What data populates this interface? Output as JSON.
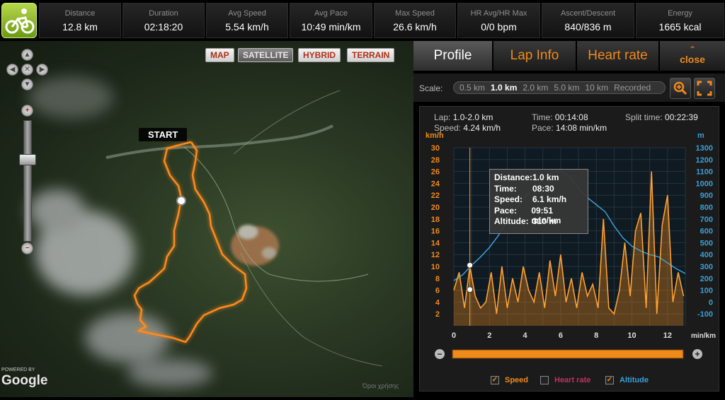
{
  "stats": [
    {
      "label": "Distance",
      "value": "12.8 km"
    },
    {
      "label": "Duration",
      "value": "02:18:20"
    },
    {
      "label": "Avg Speed",
      "value": "5.54 km/h"
    },
    {
      "label": "Avg Pace",
      "value": "10:49 min/km"
    },
    {
      "label": "Max Speed",
      "value": "26.6 km/h"
    },
    {
      "label": "HR Avg/HR Max",
      "value": "0/0 bpm"
    },
    {
      "label": "Ascent/Descent",
      "value": "840/836 m"
    },
    {
      "label": "Energy",
      "value": "1665 kcal"
    }
  ],
  "sport_icon": "cycling-icon",
  "map": {
    "types": [
      "MAP",
      "SATELLITE",
      "HYBRID",
      "TERRAIN"
    ],
    "active_type": "SATELLITE",
    "start_label": "START",
    "powered_by": "POWERED BY",
    "google": "Google",
    "terms": "Όροι χρήσης",
    "route_color": "#ff8a1c"
  },
  "panel": {
    "tabs": [
      "Profile",
      "Lap Info",
      "Heart rate"
    ],
    "active_tab": "Profile",
    "close_label": "close",
    "scale_label": "Scale:",
    "scale_options": [
      "0.5 km",
      "1.0 km",
      "2.0 km",
      "5.0 km",
      "10 km",
      "Recorded"
    ],
    "scale_selected": "1.0 km",
    "lap": {
      "k": "Lap:",
      "v": "1.0-2.0 km"
    },
    "speed": {
      "k": "Speed:",
      "v": "4.24 km/h"
    },
    "time": {
      "k": "Time:",
      "v": "00:14:08"
    },
    "pace": {
      "k": "Pace:",
      "v": "14:08 min/km"
    },
    "split": {
      "k": "Split time:",
      "v": "00:22:39"
    },
    "tooltip": [
      {
        "k": "Distance:",
        "v": "1.0 km"
      },
      {
        "k": "Time:",
        "v": "08:30"
      },
      {
        "k": "Speed:",
        "v": "6.1 km/h"
      },
      {
        "k": "Pace:",
        "v": "09:51 min/km"
      },
      {
        "k": "Altitude:",
        "v": "310 m"
      }
    ],
    "legend": [
      {
        "label": "Speed",
        "checked": true,
        "color": "#f08a18"
      },
      {
        "label": "Heart rate",
        "checked": false,
        "color": "#c0306a"
      },
      {
        "label": "Altitude",
        "checked": true,
        "color": "#3aa0d8"
      }
    ],
    "slider_minus": "−",
    "slider_plus": "+"
  },
  "chart_data": {
    "type": "line",
    "left_axis_unit": "km/h",
    "right_axis_unit": "m",
    "x_axis_unit": "min/km",
    "x_ticks": [
      "0",
      "2",
      "4",
      "6",
      "8",
      "10",
      "12"
    ],
    "y_left_ticks": [
      "2",
      "4",
      "6",
      "8",
      "10",
      "12",
      "14",
      "16",
      "18",
      "20",
      "22",
      "24",
      "26",
      "28",
      "30"
    ],
    "y_right_ticks": [
      "-100",
      "0",
      "100",
      "200",
      "300",
      "400",
      "500",
      "600",
      "700",
      "800",
      "900",
      "1000",
      "1100",
      "1200",
      "1300"
    ],
    "xlim": [
      0,
      13
    ],
    "ylim_left": [
      0,
      30
    ],
    "ylim_right": [
      -200,
      1300
    ],
    "marker_x": 0.9,
    "series": [
      {
        "name": "Altitude",
        "axis": "right",
        "x": [
          0,
          0.5,
          1,
          1.5,
          2,
          2.5,
          3,
          3.5,
          4,
          4.5,
          5,
          5.5,
          6,
          6.5,
          7,
          7.5,
          8,
          8.5,
          9,
          9.5,
          10,
          10.5,
          11,
          11.5,
          12,
          12.5,
          13
        ],
        "y": [
          180,
          230,
          310,
          380,
          460,
          560,
          680,
          790,
          880,
          970,
          1040,
          1090,
          1100,
          1060,
          960,
          880,
          820,
          760,
          640,
          540,
          470,
          430,
          400,
          380,
          330,
          280,
          240
        ]
      },
      {
        "name": "Speed",
        "axis": "left",
        "x": [
          0,
          0.3,
          0.6,
          0.9,
          1.2,
          1.5,
          1.8,
          2.1,
          2.4,
          2.7,
          3.0,
          3.3,
          3.6,
          3.9,
          4.2,
          4.5,
          4.8,
          5.1,
          5.4,
          5.7,
          6.0,
          6.3,
          6.6,
          6.9,
          7.2,
          7.5,
          7.8,
          8.1,
          8.4,
          8.7,
          9.0,
          9.3,
          9.6,
          9.9,
          10.2,
          10.5,
          10.8,
          11.1,
          11.4,
          11.7,
          12.0,
          12.3,
          12.6,
          12.9
        ],
        "y": [
          6,
          9,
          3,
          10,
          5,
          3,
          4,
          9,
          2,
          10,
          3,
          8,
          4,
          10,
          6,
          4,
          9,
          3,
          11,
          5,
          12,
          4,
          8,
          3,
          9,
          5,
          7,
          3,
          18,
          3,
          2,
          6,
          14,
          5,
          16,
          19,
          3,
          26,
          2,
          17,
          22,
          4,
          9,
          5
        ]
      }
    ]
  }
}
